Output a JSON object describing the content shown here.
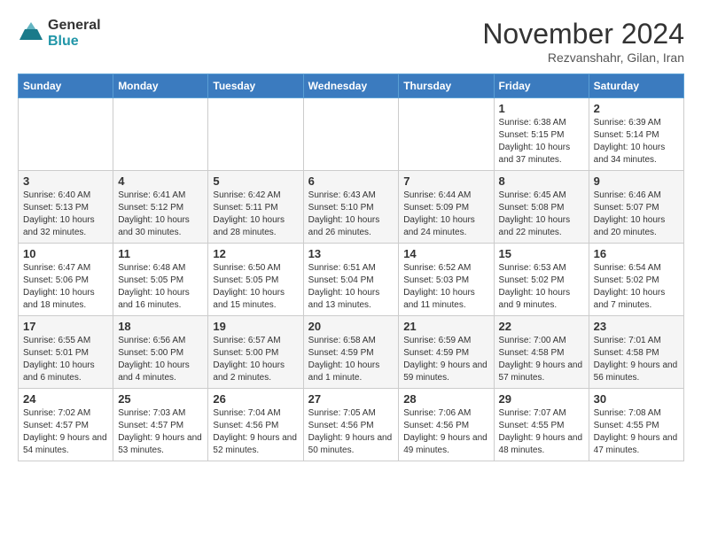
{
  "header": {
    "logo_line1": "General",
    "logo_line2": "Blue",
    "month": "November 2024",
    "location": "Rezvanshahr, Gilan, Iran"
  },
  "weekdays": [
    "Sunday",
    "Monday",
    "Tuesday",
    "Wednesday",
    "Thursday",
    "Friday",
    "Saturday"
  ],
  "weeks": [
    [
      {
        "day": "",
        "sunrise": "",
        "sunset": "",
        "daylight": ""
      },
      {
        "day": "",
        "sunrise": "",
        "sunset": "",
        "daylight": ""
      },
      {
        "day": "",
        "sunrise": "",
        "sunset": "",
        "daylight": ""
      },
      {
        "day": "",
        "sunrise": "",
        "sunset": "",
        "daylight": ""
      },
      {
        "day": "",
        "sunrise": "",
        "sunset": "",
        "daylight": ""
      },
      {
        "day": "1",
        "sunrise": "Sunrise: 6:38 AM",
        "sunset": "Sunset: 5:15 PM",
        "daylight": "Daylight: 10 hours and 37 minutes."
      },
      {
        "day": "2",
        "sunrise": "Sunrise: 6:39 AM",
        "sunset": "Sunset: 5:14 PM",
        "daylight": "Daylight: 10 hours and 34 minutes."
      }
    ],
    [
      {
        "day": "3",
        "sunrise": "Sunrise: 6:40 AM",
        "sunset": "Sunset: 5:13 PM",
        "daylight": "Daylight: 10 hours and 32 minutes."
      },
      {
        "day": "4",
        "sunrise": "Sunrise: 6:41 AM",
        "sunset": "Sunset: 5:12 PM",
        "daylight": "Daylight: 10 hours and 30 minutes."
      },
      {
        "day": "5",
        "sunrise": "Sunrise: 6:42 AM",
        "sunset": "Sunset: 5:11 PM",
        "daylight": "Daylight: 10 hours and 28 minutes."
      },
      {
        "day": "6",
        "sunrise": "Sunrise: 6:43 AM",
        "sunset": "Sunset: 5:10 PM",
        "daylight": "Daylight: 10 hours and 26 minutes."
      },
      {
        "day": "7",
        "sunrise": "Sunrise: 6:44 AM",
        "sunset": "Sunset: 5:09 PM",
        "daylight": "Daylight: 10 hours and 24 minutes."
      },
      {
        "day": "8",
        "sunrise": "Sunrise: 6:45 AM",
        "sunset": "Sunset: 5:08 PM",
        "daylight": "Daylight: 10 hours and 22 minutes."
      },
      {
        "day": "9",
        "sunrise": "Sunrise: 6:46 AM",
        "sunset": "Sunset: 5:07 PM",
        "daylight": "Daylight: 10 hours and 20 minutes."
      }
    ],
    [
      {
        "day": "10",
        "sunrise": "Sunrise: 6:47 AM",
        "sunset": "Sunset: 5:06 PM",
        "daylight": "Daylight: 10 hours and 18 minutes."
      },
      {
        "day": "11",
        "sunrise": "Sunrise: 6:48 AM",
        "sunset": "Sunset: 5:05 PM",
        "daylight": "Daylight: 10 hours and 16 minutes."
      },
      {
        "day": "12",
        "sunrise": "Sunrise: 6:50 AM",
        "sunset": "Sunset: 5:05 PM",
        "daylight": "Daylight: 10 hours and 15 minutes."
      },
      {
        "day": "13",
        "sunrise": "Sunrise: 6:51 AM",
        "sunset": "Sunset: 5:04 PM",
        "daylight": "Daylight: 10 hours and 13 minutes."
      },
      {
        "day": "14",
        "sunrise": "Sunrise: 6:52 AM",
        "sunset": "Sunset: 5:03 PM",
        "daylight": "Daylight: 10 hours and 11 minutes."
      },
      {
        "day": "15",
        "sunrise": "Sunrise: 6:53 AM",
        "sunset": "Sunset: 5:02 PM",
        "daylight": "Daylight: 10 hours and 9 minutes."
      },
      {
        "day": "16",
        "sunrise": "Sunrise: 6:54 AM",
        "sunset": "Sunset: 5:02 PM",
        "daylight": "Daylight: 10 hours and 7 minutes."
      }
    ],
    [
      {
        "day": "17",
        "sunrise": "Sunrise: 6:55 AM",
        "sunset": "Sunset: 5:01 PM",
        "daylight": "Daylight: 10 hours and 6 minutes."
      },
      {
        "day": "18",
        "sunrise": "Sunrise: 6:56 AM",
        "sunset": "Sunset: 5:00 PM",
        "daylight": "Daylight: 10 hours and 4 minutes."
      },
      {
        "day": "19",
        "sunrise": "Sunrise: 6:57 AM",
        "sunset": "Sunset: 5:00 PM",
        "daylight": "Daylight: 10 hours and 2 minutes."
      },
      {
        "day": "20",
        "sunrise": "Sunrise: 6:58 AM",
        "sunset": "Sunset: 4:59 PM",
        "daylight": "Daylight: 10 hours and 1 minute."
      },
      {
        "day": "21",
        "sunrise": "Sunrise: 6:59 AM",
        "sunset": "Sunset: 4:59 PM",
        "daylight": "Daylight: 9 hours and 59 minutes."
      },
      {
        "day": "22",
        "sunrise": "Sunrise: 7:00 AM",
        "sunset": "Sunset: 4:58 PM",
        "daylight": "Daylight: 9 hours and 57 minutes."
      },
      {
        "day": "23",
        "sunrise": "Sunrise: 7:01 AM",
        "sunset": "Sunset: 4:58 PM",
        "daylight": "Daylight: 9 hours and 56 minutes."
      }
    ],
    [
      {
        "day": "24",
        "sunrise": "Sunrise: 7:02 AM",
        "sunset": "Sunset: 4:57 PM",
        "daylight": "Daylight: 9 hours and 54 minutes."
      },
      {
        "day": "25",
        "sunrise": "Sunrise: 7:03 AM",
        "sunset": "Sunset: 4:57 PM",
        "daylight": "Daylight: 9 hours and 53 minutes."
      },
      {
        "day": "26",
        "sunrise": "Sunrise: 7:04 AM",
        "sunset": "Sunset: 4:56 PM",
        "daylight": "Daylight: 9 hours and 52 minutes."
      },
      {
        "day": "27",
        "sunrise": "Sunrise: 7:05 AM",
        "sunset": "Sunset: 4:56 PM",
        "daylight": "Daylight: 9 hours and 50 minutes."
      },
      {
        "day": "28",
        "sunrise": "Sunrise: 7:06 AM",
        "sunset": "Sunset: 4:56 PM",
        "daylight": "Daylight: 9 hours and 49 minutes."
      },
      {
        "day": "29",
        "sunrise": "Sunrise: 7:07 AM",
        "sunset": "Sunset: 4:55 PM",
        "daylight": "Daylight: 9 hours and 48 minutes."
      },
      {
        "day": "30",
        "sunrise": "Sunrise: 7:08 AM",
        "sunset": "Sunset: 4:55 PM",
        "daylight": "Daylight: 9 hours and 47 minutes."
      }
    ]
  ]
}
